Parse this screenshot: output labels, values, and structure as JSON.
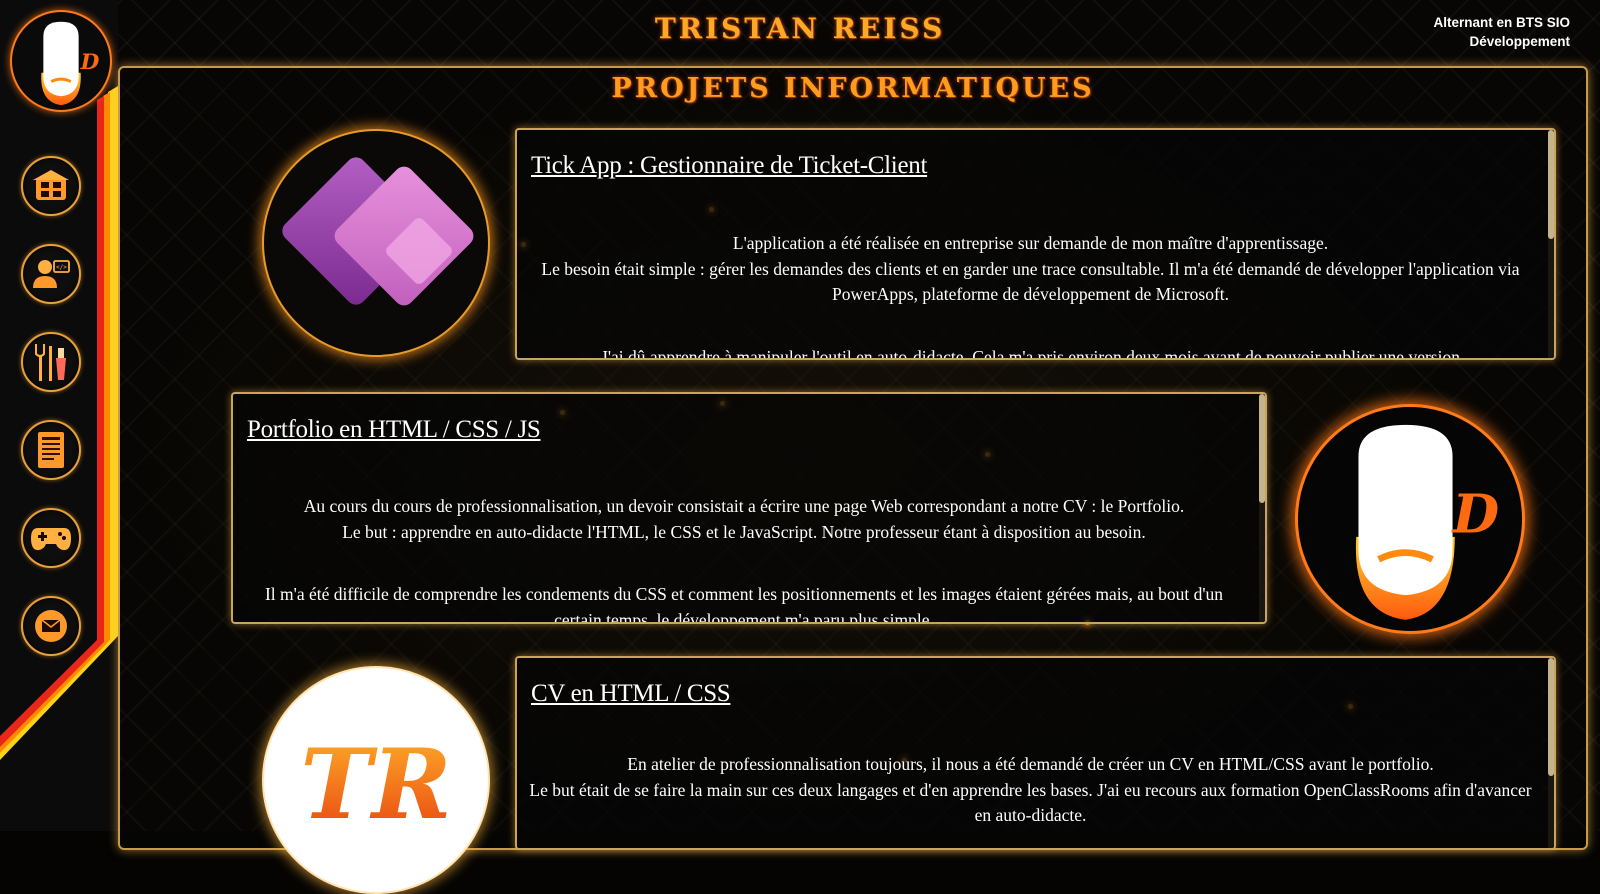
{
  "header": {
    "title": "TRISTAN REISS",
    "subtitle_line1": "Alternant en BTS SIO",
    "subtitle_line2": "Développement"
  },
  "sidebar": {
    "avatar_icon": "bald-bearded-face-logo",
    "items": [
      {
        "name": "home",
        "icon": "house-icon"
      },
      {
        "name": "profile",
        "icon": "person-computer-icon"
      },
      {
        "name": "hobbies",
        "icon": "cutlery-drink-icon"
      },
      {
        "name": "projects",
        "icon": "document-icon"
      },
      {
        "name": "games",
        "icon": "gamepad-icon"
      },
      {
        "name": "contact",
        "icon": "envelope-icon"
      }
    ]
  },
  "main": {
    "title": "PROJETS INFORMATIQUES",
    "projects": [
      {
        "title": "Tick App : Gestionnaire de Ticket-Client",
        "image": "powerapps-logo",
        "p1": "L'application a été réalisée en entreprise sur demande de mon maître d'apprentissage.",
        "p2": "Le besoin était simple : gérer les demandes des clients et en garder une trace consultable. Il m'a été demandé de développer l'application via PowerApps, plateforme de développement de Microsoft.",
        "p3": "J'ai dû apprendre à manipuler l'outil en auto-didacte. Cela m'a pris environ deux mois avant de pouvoir publier une version"
      },
      {
        "title": "Portfolio en HTML / CSS / JS",
        "image": "bald-bearded-face-logo",
        "p1": "Au cours du cours de professionnalisation, un devoir consistait a écrire une page Web correspondant a notre CV : le Portfolio.",
        "p2": "Le but : apprendre en auto-didacte l'HTML, le CSS et le JavaScript. Notre professeur étant à disposition au besoin.",
        "p3": "Il m'a été difficile de comprendre les condements du CSS et comment les positionnements et les images étaient gérées mais, au bout d'un certain temps, le développement m'a paru plus simple."
      },
      {
        "title": "CV en HTML / CSS",
        "image": "tr-monogram-logo",
        "image_text": "TR",
        "p1": "En atelier de professionnalisation toujours, il nous a été demandé de créer un CV en HTML/CSS avant le portfolio.",
        "p2": "Le but était de se faire la main sur ces deux langages et d'en apprendre les bases. J'ai eu recours aux formation OpenClassRooms afin d'avancer en auto-didacte."
      }
    ]
  },
  "colors": {
    "accent": "#ffa826",
    "border": "#c9a45e",
    "stripe_red": "#e8261a",
    "stripe_orange": "#ff8a00",
    "stripe_yellow": "#ffd21a"
  }
}
